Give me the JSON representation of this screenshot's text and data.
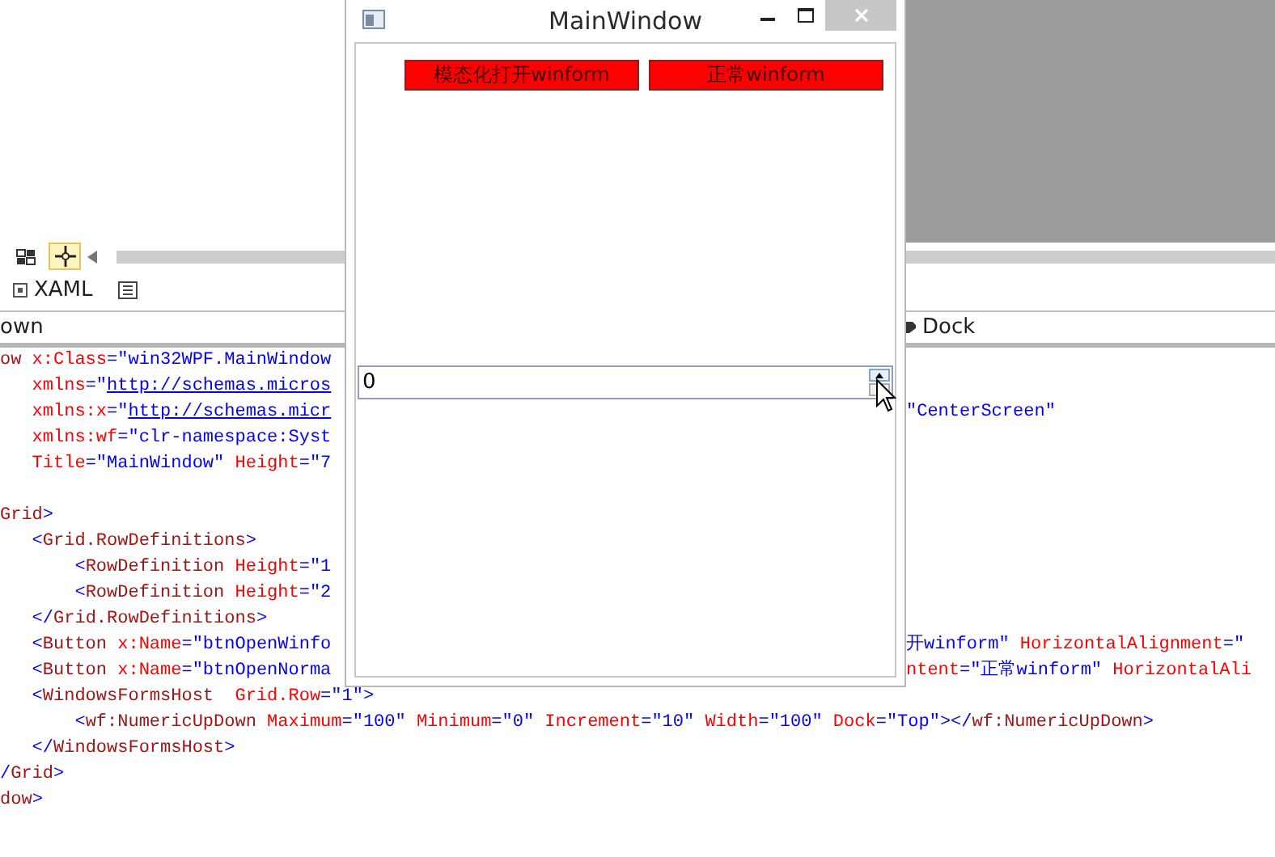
{
  "designer": {
    "toolbar_buttons": [
      {
        "selected": false
      },
      {
        "selected": true
      }
    ]
  },
  "view_tabs": [
    {
      "label": "XAML"
    }
  ],
  "breadcrumb": "own",
  "property_label": "Dock",
  "code_blocks": [
    [
      {
        "left": [
          {
            "tag": "ow"
          },
          {
            "attr": " x:Class"
          },
          {
            "value": "=\"win32WPF.MainWindow"
          }
        ]
      },
      {
        "left": [
          {
            "attr": "   xmlns"
          },
          {
            "value": "=\""
          },
          {
            "url": "http://schemas.micros"
          }
        ]
      },
      {
        "left": [
          {
            "attr": "   xmlns:x"
          },
          {
            "value": "=\""
          },
          {
            "url": "http://schemas.micr"
          }
        ],
        "right": [
          {
            "value": "\"CenterScreen\""
          }
        ]
      },
      {
        "left": [
          {
            "attr": "   xmlns:wf"
          },
          {
            "value": "=\"clr-namespace:Syst"
          }
        ]
      },
      {
        "left": [
          {
            "attr": "   Title"
          },
          {
            "value": "=\"MainWindow\""
          },
          {
            "attr": " Height"
          },
          {
            "value": "=\"7"
          }
        ]
      }
    ],
    [
      {
        "left": [
          {
            "tag": "Grid"
          },
          {
            "value": ">"
          }
        ]
      },
      {
        "left": [
          {
            "value": "   <"
          },
          {
            "tag": "Grid.RowDefinitions"
          },
          {
            "value": ">"
          }
        ]
      },
      {
        "left": [
          {
            "value": "       <"
          },
          {
            "tag": "RowDefinition"
          },
          {
            "attr": " Height"
          },
          {
            "value": "=\"1"
          }
        ]
      },
      {
        "left": [
          {
            "value": "       <"
          },
          {
            "tag": "RowDefinition"
          },
          {
            "attr": " Height"
          },
          {
            "value": "=\"2"
          }
        ]
      },
      {
        "left": [
          {
            "value": "   </"
          },
          {
            "tag": "Grid.RowDefinitions"
          },
          {
            "value": ">"
          }
        ]
      },
      {
        "left": [
          {
            "value": "   <"
          },
          {
            "tag": "Button"
          },
          {
            "attr": " x:Name"
          },
          {
            "value": "=\"btnOpenWinfo"
          }
        ],
        "right": [
          {
            "value": "开winform\""
          },
          {
            "attr": " HorizontalAlignment"
          },
          {
            "value": "=\""
          }
        ]
      },
      {
        "left": [
          {
            "value": "   <"
          },
          {
            "tag": "Button"
          },
          {
            "attr": " x:Name"
          },
          {
            "value": "=\"btnOpenNorma"
          }
        ],
        "right": [
          {
            "attr": "ntent"
          },
          {
            "value": "=\"正常winform\""
          },
          {
            "attr": " HorizontalAli"
          }
        ]
      },
      {
        "left": [
          {
            "value": "   <"
          },
          {
            "tag": "WindowsFormsHost"
          },
          {
            "attr": "  Grid.Row"
          },
          {
            "value": "=\"1\">"
          }
        ]
      },
      {
        "left": [
          {
            "value": "       <"
          },
          {
            "tag": "wf:NumericUpDown"
          },
          {
            "attr": " Maximum"
          },
          {
            "value": "=\"100\""
          },
          {
            "attr": " Minimum"
          },
          {
            "value": "=\"0\""
          },
          {
            "attr": " Increment"
          },
          {
            "value": "=\"10\""
          },
          {
            "attr": " Width"
          },
          {
            "value": "=\"100\""
          },
          {
            "attr": " Dock"
          },
          {
            "value": "=\"Top\"></"
          },
          {
            "tag": "wf:NumericUpDown"
          },
          {
            "value": ">"
          }
        ]
      },
      {
        "left": [
          {
            "value": "   </"
          },
          {
            "tag": "WindowsFormsHost"
          },
          {
            "value": ">"
          }
        ]
      },
      {
        "left": [
          {
            "value": "/"
          },
          {
            "tag": "Grid"
          },
          {
            "value": ">"
          }
        ]
      },
      {
        "left": [
          {
            "tag": "dow"
          },
          {
            "value": ">"
          }
        ]
      }
    ]
  ],
  "window": {
    "title": "MainWindow",
    "buttons": [
      "模态化打开winform",
      "正常winform"
    ],
    "numeric_updown": {
      "value": "0"
    }
  }
}
